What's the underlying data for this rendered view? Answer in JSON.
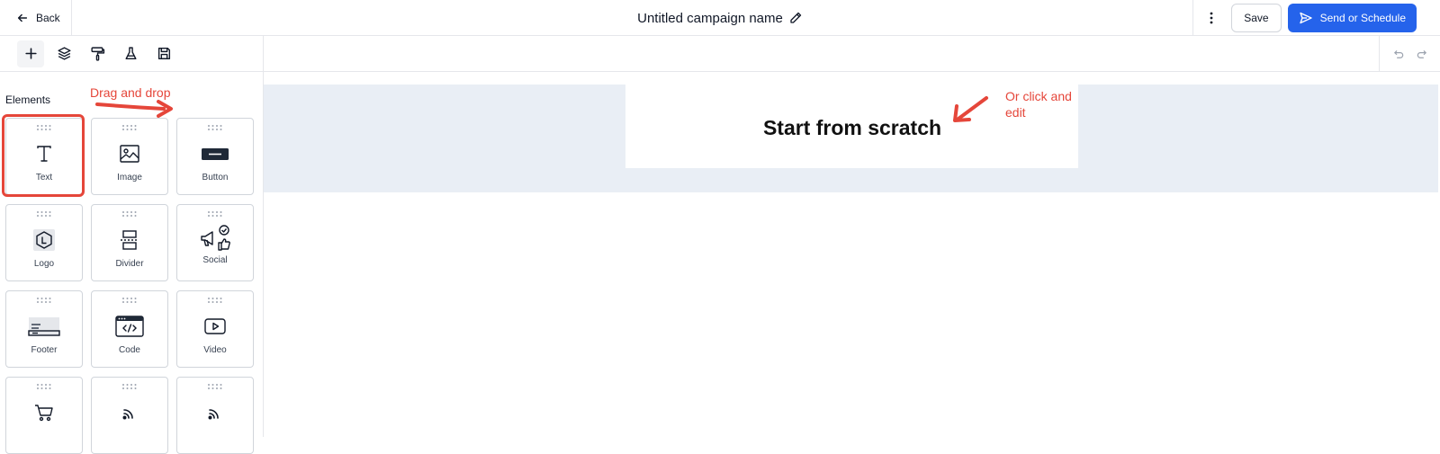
{
  "header": {
    "back_label": "Back",
    "campaign_title": "Untitled campaign name",
    "save_label": "Save",
    "send_label": "Send or Schedule"
  },
  "toolbar": {
    "tools": [
      "add-icon",
      "layers-icon",
      "paint-roller-icon",
      "flask-icon",
      "save-template-icon"
    ],
    "active_tool": "add-icon"
  },
  "sidebar": {
    "section_title": "Elements",
    "elements": [
      {
        "label": "Text",
        "icon": "text-icon"
      },
      {
        "label": "Image",
        "icon": "image-icon"
      },
      {
        "label": "Button",
        "icon": "button-icon"
      },
      {
        "label": "Logo",
        "icon": "logo-icon"
      },
      {
        "label": "Divider",
        "icon": "divider-icon"
      },
      {
        "label": "Social",
        "icon": "social-icon"
      },
      {
        "label": "Footer",
        "icon": "footer-icon"
      },
      {
        "label": "Code",
        "icon": "code-icon"
      },
      {
        "label": "Video",
        "icon": "video-icon"
      },
      {
        "label": "",
        "icon": "cart-icon"
      },
      {
        "label": "",
        "icon": "rss-icon"
      },
      {
        "label": "",
        "icon": "rss-icon"
      }
    ]
  },
  "canvas": {
    "heading": "Start from scratch"
  },
  "annotations": {
    "drag": "Drag and drop",
    "click_line1": "Or click and",
    "click_line2": "edit"
  },
  "colors": {
    "accent": "#2563eb",
    "annotation": "#e5463a",
    "canvas_band": "#e9eef5"
  }
}
